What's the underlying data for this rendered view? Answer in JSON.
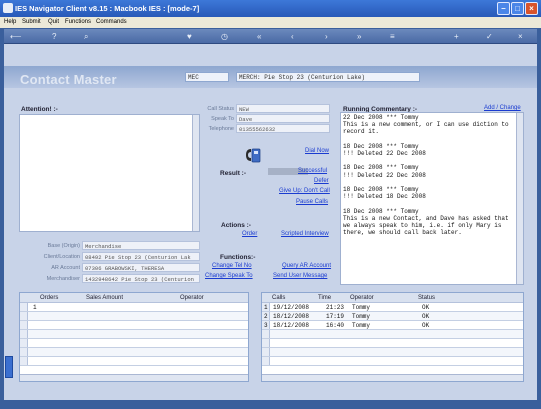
{
  "window": {
    "title": "IES Navigator Client v8.15 : Macbook IES :    [mode-7]"
  },
  "menu": [
    "Help",
    "Submit",
    "Quit",
    "Functions",
    "Commands"
  ],
  "page": {
    "heading": "Contact Master",
    "code": "MEC",
    "contact": "MERCH: Pie Stop 23 (Centurion Lake)"
  },
  "attention_label": "Attention! :-",
  "call": {
    "status_label": "Call Status",
    "status": "NEW",
    "speak_to_label": "Speak To",
    "speak_to": "Dave",
    "telephone_label": "Telephone",
    "telephone": "01355562632"
  },
  "result": {
    "label": "Result :-",
    "dial_now": "Dial Now",
    "successful": "Successful",
    "defer": "Defer",
    "give_up": "Give Up: Don't Call",
    "pause": "Pause Calls"
  },
  "actions": {
    "label": "Actions :-",
    "order": "Order",
    "scripted": "Scripted Interview"
  },
  "functions": {
    "label": "Functions:-",
    "change_tel": "Change Tel No",
    "change_speak": "Change Speak To",
    "query_ar": "Query AR Account",
    "send_message": "Send User Message"
  },
  "details": {
    "base_label": "Base (Origin)",
    "base": "Merchandise",
    "client_label": "Client/Location",
    "client": "08492 Pie Stop 23 (Centurion Lak",
    "ar_label": "AR Account",
    "ar": "07306 GRABOWSKI, THERESA",
    "merchant_label": "Merchandiser",
    "merchant": "1432948642 Pie Stop 23 (Centurion"
  },
  "commentary": {
    "label": "Running Commentary :-",
    "add_change": "Add / Change",
    "text": "22 Dec 2008 *** Tommy\nThis is a new comment, or I can use diction to record it.\n\n18 Dec 2008 *** Tommy\n!!! Deleted 22 Dec 2008\n\n18 Dec 2008 *** Tommy\n!!! Deleted 22 Dec 2008\n\n18 Dec 2008 *** Tommy\n!!! Deleted 18 Dec 2008\n\n18 Dec 2008 *** Tommy\nThis is a new Contact, and Dave has asked that we always speak to him, i.e. if only Mary is there, we should call back later."
  },
  "orders": {
    "columns": [
      "Orders",
      "Sales Amount",
      "Operator"
    ],
    "rows": [
      {
        "num": "1",
        "order": "",
        "amount": "",
        "operator": ""
      }
    ]
  },
  "calls": {
    "columns": [
      "Calls",
      "Time",
      "Operator",
      "Status"
    ],
    "rows": [
      {
        "num": "1",
        "date": "19/12/2008",
        "time": "21:23",
        "operator": "Tommy",
        "status": "OK"
      },
      {
        "num": "2",
        "date": "18/12/2008",
        "time": "17:19",
        "operator": "Tommy",
        "status": "OK"
      },
      {
        "num": "3",
        "date": "18/12/2008",
        "time": "16:40",
        "operator": "Tommy",
        "status": "OK"
      }
    ]
  },
  "colors": {
    "accent": "#1a3bd0",
    "frame": "#c8d3e8",
    "titlebar": "#2859b8",
    "desktop": "#3a5f9c"
  },
  "icons": {
    "phone": "telephone-icon"
  }
}
